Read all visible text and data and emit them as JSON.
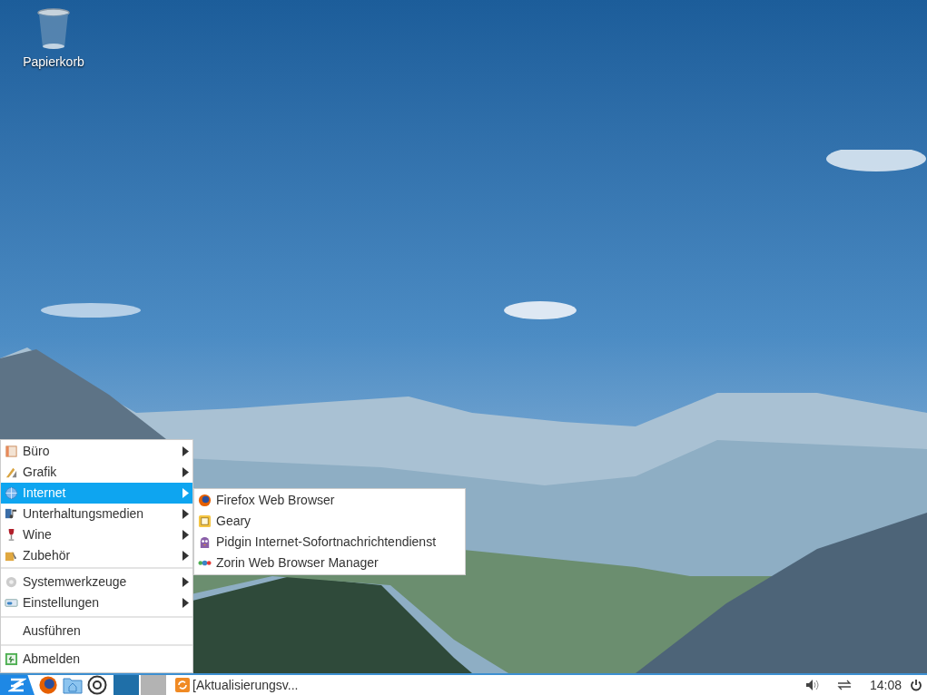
{
  "desktop_icons": [
    {
      "label": "Papierkorb"
    }
  ],
  "menu": {
    "groups": [
      [
        {
          "label": "Büro",
          "selected": false,
          "submenu": true
        },
        {
          "label": "Grafik",
          "selected": false,
          "submenu": true
        },
        {
          "label": "Internet",
          "selected": true,
          "submenu": true
        },
        {
          "label": "Unterhaltungsmedien",
          "selected": false,
          "submenu": true
        },
        {
          "label": "Wine",
          "selected": false,
          "submenu": true
        },
        {
          "label": "Zubehör",
          "selected": false,
          "submenu": true
        }
      ],
      [
        {
          "label": "Systemwerkzeuge",
          "selected": false,
          "submenu": true
        },
        {
          "label": "Einstellungen",
          "selected": false,
          "submenu": true
        }
      ],
      [
        {
          "label": "Ausführen",
          "selected": false,
          "submenu": false
        }
      ],
      [
        {
          "label": "Abmelden",
          "selected": false,
          "submenu": false
        }
      ]
    ]
  },
  "submenu": {
    "items": [
      {
        "label": "Firefox Web Browser"
      },
      {
        "label": "Geary"
      },
      {
        "label": "Pidgin Internet-Sofortnachrichtendienst"
      },
      {
        "label": "Zorin Web Browser Manager"
      }
    ]
  },
  "taskbar": {
    "workspaces": [
      {
        "selected": true
      },
      {
        "selected": false
      }
    ],
    "tasks": [
      {
        "label": "[Aktualisierungsv..."
      }
    ],
    "clock": "14:08"
  }
}
